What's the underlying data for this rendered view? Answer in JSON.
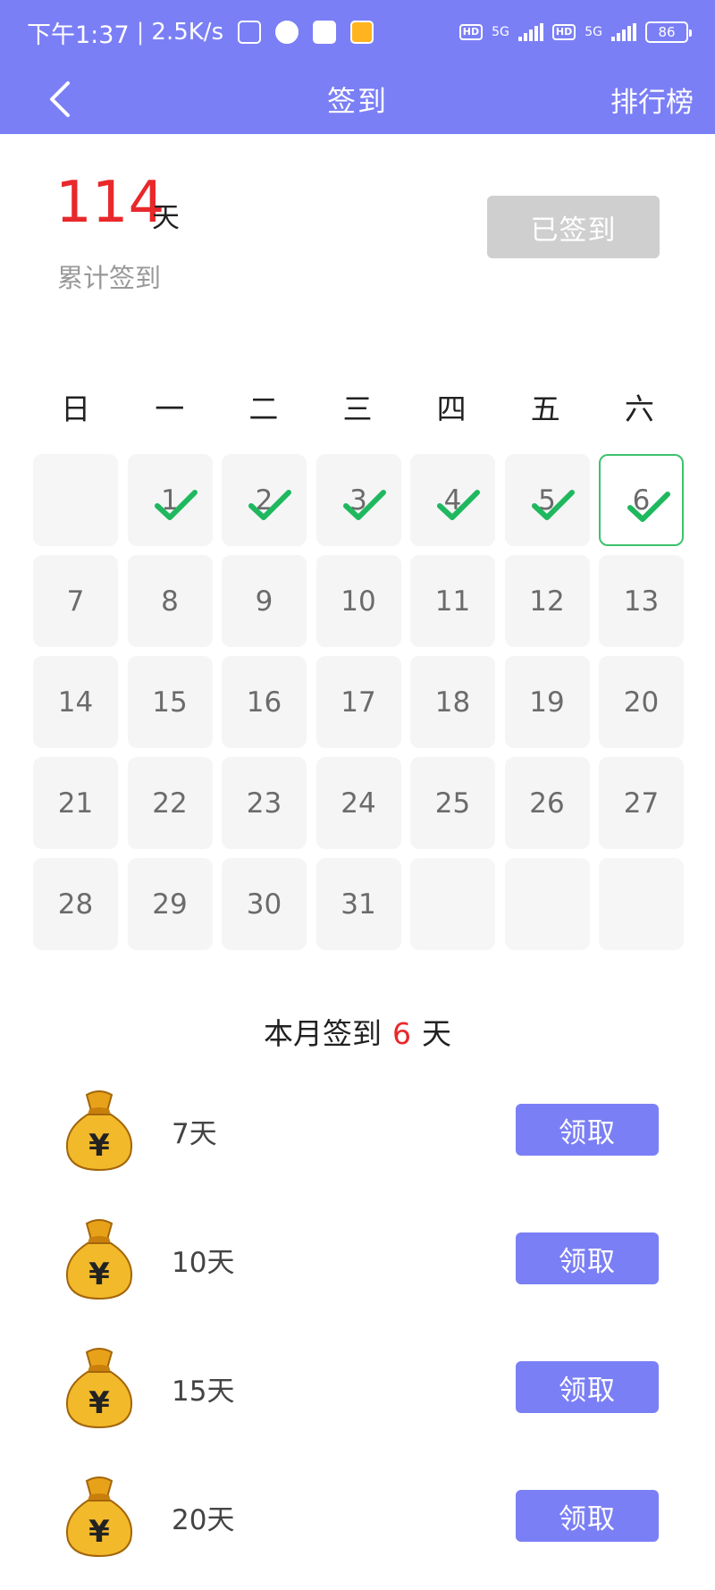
{
  "status_bar": {
    "time": "下午1:37",
    "speed": "2.5K/s",
    "hd_1": "HD",
    "net_1": "5G",
    "hd_2": "HD",
    "net_2": "5G",
    "battery": "86"
  },
  "nav": {
    "title": "签到",
    "ranking": "排行榜"
  },
  "summary": {
    "total_days": "114",
    "unit": "天",
    "total_label": "累计签到",
    "signed_button": "已签到"
  },
  "calendar": {
    "weekdays": [
      "日",
      "一",
      "二",
      "三",
      "四",
      "五",
      "六"
    ],
    "days": [
      "",
      "1",
      "2",
      "3",
      "4",
      "5",
      "6",
      "7",
      "8",
      "9",
      "10",
      "11",
      "12",
      "13",
      "14",
      "15",
      "16",
      "17",
      "18",
      "19",
      "20",
      "21",
      "22",
      "23",
      "24",
      "25",
      "26",
      "27",
      "28",
      "29",
      "30",
      "31",
      "",
      "",
      ""
    ],
    "checked_days": [
      "1",
      "2",
      "3",
      "4",
      "5",
      "6"
    ],
    "today": "6"
  },
  "month": {
    "prefix": "本月签到",
    "count": "6",
    "suffix": "天"
  },
  "rewards": [
    {
      "label": "7天",
      "button": "领取"
    },
    {
      "label": "10天",
      "button": "领取"
    },
    {
      "label": "15天",
      "button": "领取"
    },
    {
      "label": "20天",
      "button": "领取"
    }
  ],
  "colors": {
    "accent": "#7b7ff5",
    "highlight": "#e8282b",
    "check": "#1fb85f",
    "signed_button": "#cfcfcf"
  }
}
